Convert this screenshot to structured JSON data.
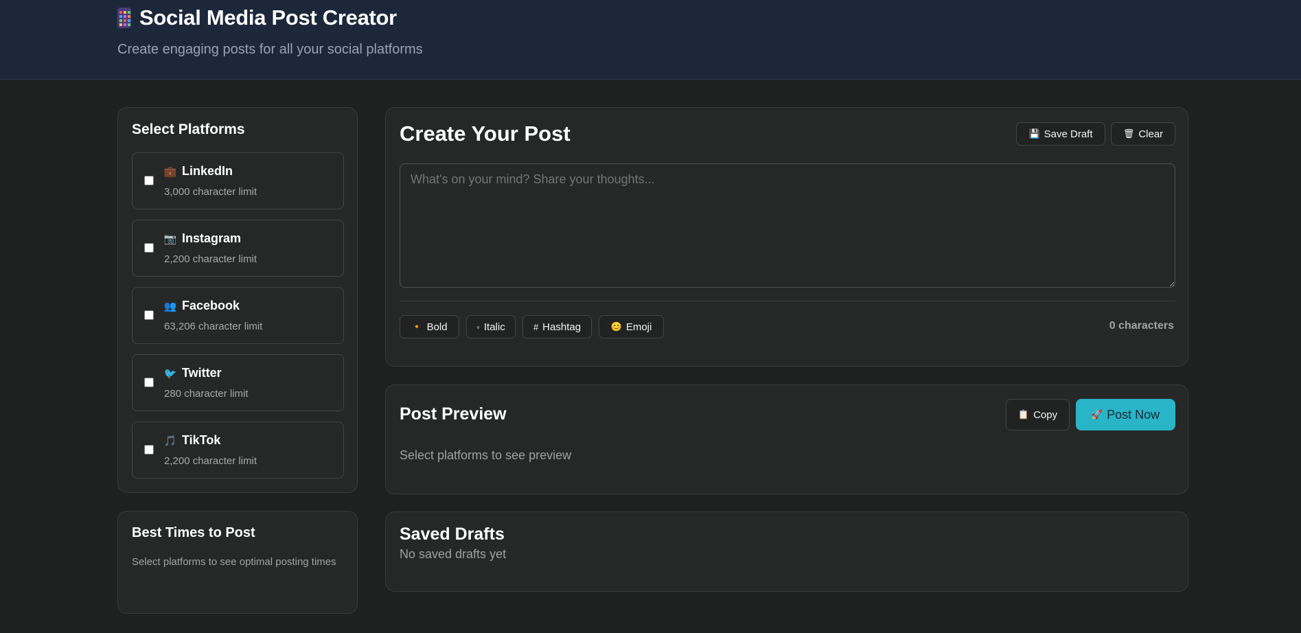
{
  "header": {
    "app_icon": "calculator-icon",
    "title": "Social Media Post Creator",
    "subtitle": "Create engaging posts for all your social platforms"
  },
  "platforms": {
    "heading": "Select Platforms",
    "items": [
      {
        "name": "LinkedIn",
        "icon": "briefcase-icon",
        "glyph": "💼",
        "limit": "3,000 character limit",
        "checked": false
      },
      {
        "name": "Instagram",
        "icon": "camera-icon",
        "glyph": "📷",
        "limit": "2,200 character limit",
        "checked": false
      },
      {
        "name": "Facebook",
        "icon": "people-icon",
        "glyph": "👥",
        "limit": "63,206 character limit",
        "checked": false
      },
      {
        "name": "Twitter",
        "icon": "bird-icon",
        "glyph": "🐦",
        "limit": "280 character limit",
        "checked": false
      },
      {
        "name": "TikTok",
        "icon": "music-note-icon",
        "glyph": "🎵",
        "limit": "2,200 character limit",
        "checked": false
      }
    ]
  },
  "best_times": {
    "heading": "Best Times to Post",
    "note": "Select platforms to see optimal posting times"
  },
  "create": {
    "heading": "Create Your Post",
    "save_draft_icon": "floppy-disk-icon",
    "save_draft_glyph": "💾",
    "save_draft_label": "Save Draft",
    "clear_icon": "trash-icon",
    "clear_glyph": "🗑",
    "clear_label": "Clear",
    "placeholder": "What's on your mind? Share your thoughts...",
    "value": "",
    "format_buttons": [
      {
        "label": "Bold",
        "icon": "diamond-icon",
        "glyph": "🔸"
      },
      {
        "label": "Italic",
        "icon": "small-circle-icon",
        "glyph": "◦"
      },
      {
        "label": "Hashtag",
        "icon": "hash-icon",
        "glyph": "#"
      },
      {
        "label": "Emoji",
        "icon": "smile-icon",
        "glyph": "😊"
      }
    ],
    "char_count": "0 characters"
  },
  "preview": {
    "heading": "Post Preview",
    "copy_icon": "clipboard-icon",
    "copy_glyph": "📋",
    "copy_label": "Copy",
    "post_now_icon": "rocket-icon",
    "post_now_glyph": "🚀",
    "post_now_label": "Post Now",
    "note": "Select platforms to see preview"
  },
  "drafts": {
    "heading": "Saved Drafts",
    "note": "No saved drafts yet"
  },
  "colors": {
    "accent": "#2ab4c8",
    "header_bg": "#1d273a",
    "page_bg": "#1f2020",
    "card_bg": "#262727"
  }
}
